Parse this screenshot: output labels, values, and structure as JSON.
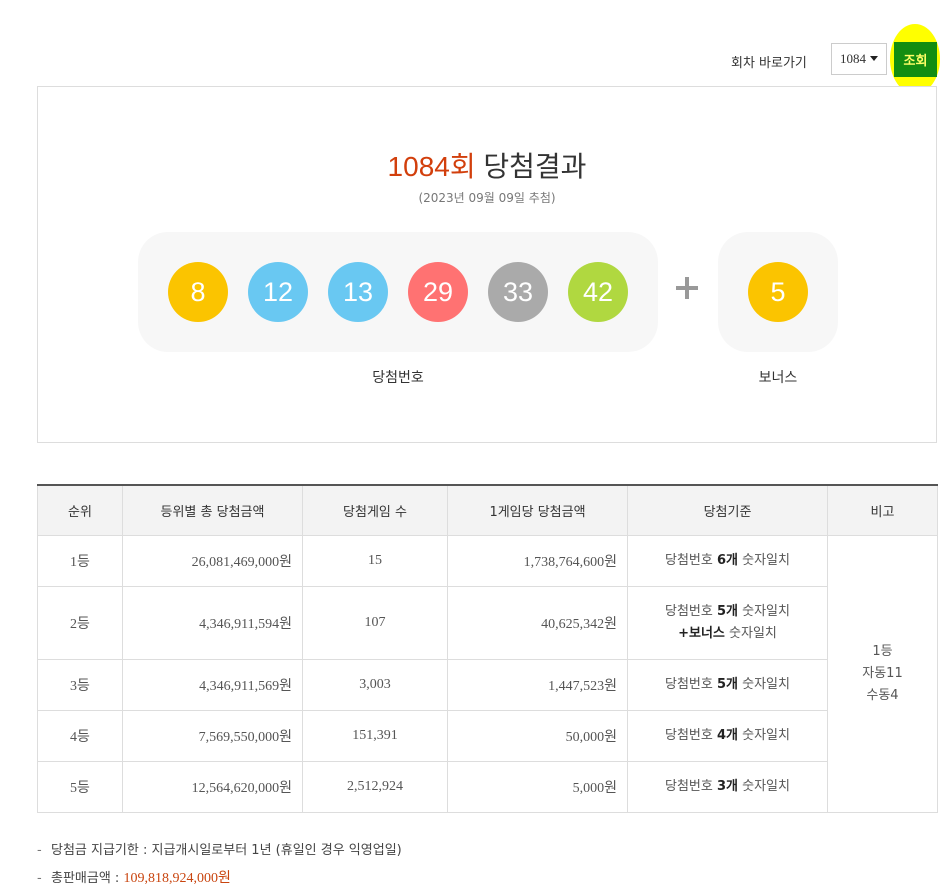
{
  "goto": {
    "label": "회차 바로가기",
    "selected_round": "1084",
    "search_label": "조회"
  },
  "result": {
    "round_label": "1084회",
    "title_suffix": "당첨결과",
    "draw_date": "(2023년 09월 09일 추첨)",
    "numbers": [
      {
        "value": "8",
        "color": "#fbc400"
      },
      {
        "value": "12",
        "color": "#69c8f2"
      },
      {
        "value": "13",
        "color": "#69c8f2"
      },
      {
        "value": "29",
        "color": "#ff7272"
      },
      {
        "value": "33",
        "color": "#aaaaaa"
      },
      {
        "value": "42",
        "color": "#b0d840"
      }
    ],
    "bonus": {
      "value": "5",
      "color": "#fbc400"
    },
    "numbers_caption": "당첨번호",
    "bonus_caption": "보너스"
  },
  "table": {
    "headers": [
      "순위",
      "등위별 총 당첨금액",
      "당첨게임 수",
      "1게임당 당첨금액",
      "당첨기준",
      "비고"
    ],
    "rows": [
      {
        "rank": "1등",
        "total": "26,081,469,000원",
        "games": "15",
        "per_game": "1,738,764,600원",
        "crit_prefix": "당첨번호 ",
        "crit_bold": "6개",
        "crit_suffix": " 숫자일치",
        "crit_line2_bold": "",
        "crit_line2_suffix": ""
      },
      {
        "rank": "2등",
        "total": "4,346,911,594원",
        "games": "107",
        "per_game": "40,625,342원",
        "crit_prefix": "당첨번호 ",
        "crit_bold": "5개",
        "crit_suffix": " 숫자일치",
        "crit_line2_bold": "+보너스",
        "crit_line2_suffix": " 숫자일치"
      },
      {
        "rank": "3등",
        "total": "4,346,911,569원",
        "games": "3,003",
        "per_game": "1,447,523원",
        "crit_prefix": "당첨번호 ",
        "crit_bold": "5개",
        "crit_suffix": " 숫자일치",
        "crit_line2_bold": "",
        "crit_line2_suffix": ""
      },
      {
        "rank": "4등",
        "total": "7,569,550,000원",
        "games": "151,391",
        "per_game": "50,000원",
        "crit_prefix": "당첨번호 ",
        "crit_bold": "4개",
        "crit_suffix": " 숫자일치",
        "crit_line2_bold": "",
        "crit_line2_suffix": ""
      },
      {
        "rank": "5등",
        "total": "12,564,620,000원",
        "games": "2,512,924",
        "per_game": "5,000원",
        "crit_prefix": "당첨번호 ",
        "crit_bold": "3개",
        "crit_suffix": " 숫자일치",
        "crit_line2_bold": "",
        "crit_line2_suffix": ""
      }
    ],
    "note": {
      "line1": "1등",
      "line2": "자동11",
      "line3": "수동4"
    }
  },
  "footnotes": {
    "deadline": "당첨금 지급기한 : 지급개시일로부터 1년 (휴일인 경우 익영업일)",
    "sales_label": "총판매금액 : ",
    "sales_value": "109,818,924,000원",
    "dash": "-"
  }
}
